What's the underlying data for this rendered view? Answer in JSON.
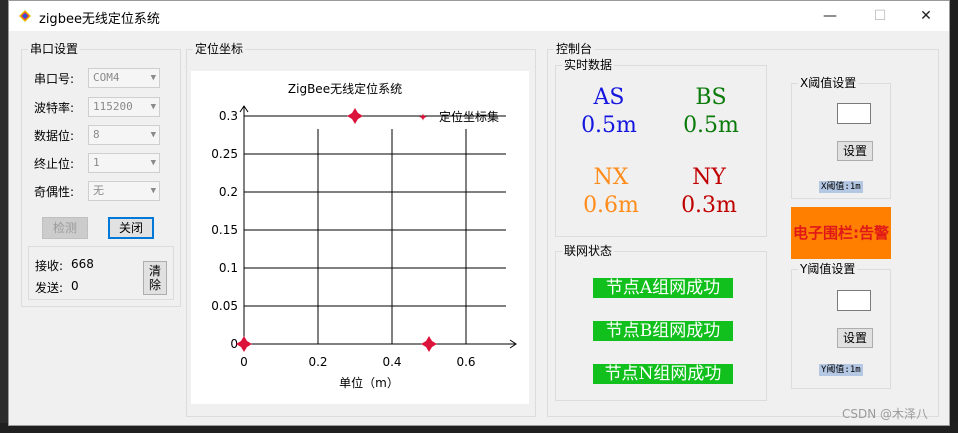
{
  "window": {
    "title": "zigbee无线定位系统",
    "min_label": "—",
    "max_label": "☐",
    "close_label": "✕"
  },
  "serial": {
    "group_title": "串口设置",
    "port_label": "串口号:",
    "port_value": "COM4",
    "baud_label": "波特率:",
    "baud_value": "115200",
    "databits_label": "数据位:",
    "databits_value": "8",
    "stopbits_label": "终止位:",
    "stopbits_value": "1",
    "parity_label": "奇偶性:",
    "parity_value": "无",
    "detect_button": "检测",
    "close_button": "关闭",
    "recv_label": "接收:",
    "recv_value": "668",
    "send_label": "发送:",
    "send_value": "0",
    "clear_button_line1": "清",
    "clear_button_line2": "除"
  },
  "coord": {
    "group_title": "定位坐标"
  },
  "chart_data": {
    "type": "scatter",
    "title": "ZigBee无线定位系统",
    "xlabel": "单位（m）",
    "ylabel": "",
    "xlim": [
      0,
      0.7
    ],
    "ylim": [
      0,
      0.3
    ],
    "xticks": [
      "0",
      "0.2",
      "0.4",
      "0.6"
    ],
    "yticks": [
      "0",
      "0.05",
      "0.1",
      "0.15",
      "0.2",
      "0.25",
      "0.3"
    ],
    "grid": true,
    "legend_position": "top-right",
    "series": [
      {
        "name": "定位坐标集",
        "color": "#dc143c",
        "points": [
          {
            "x": 0,
            "y": 0
          },
          {
            "x": 0.3,
            "y": 0.3
          },
          {
            "x": 0.5,
            "y": 0
          }
        ]
      }
    ]
  },
  "console": {
    "group_title": "控制台",
    "realtime_title": "实时数据",
    "as_label": "AS",
    "as_value": "0.5m",
    "as_color": "#1515e0",
    "bs_label": "BS",
    "bs_value": "0.5m",
    "bs_color": "#0a7a0a",
    "nx_label": "NX",
    "nx_value": "0.6m",
    "nx_color": "#ff8c1a",
    "ny_label": "NY",
    "ny_value": "0.3m",
    "ny_color": "#c00000",
    "network_title": "联网状态",
    "node_a": "节点A组网成功",
    "node_b": "节点B组网成功",
    "node_n": "节点N组网成功",
    "x_threshold_title": "X阈值设置",
    "x_set_button": "设置",
    "x_threshold_value": "X阈值:1m",
    "fence_text": "电子围栏:告警",
    "y_threshold_title": "Y阈值设置",
    "y_set_button": "设置",
    "y_threshold_value": "Y阈值:1m"
  },
  "watermark": "CSDN @木泽八"
}
